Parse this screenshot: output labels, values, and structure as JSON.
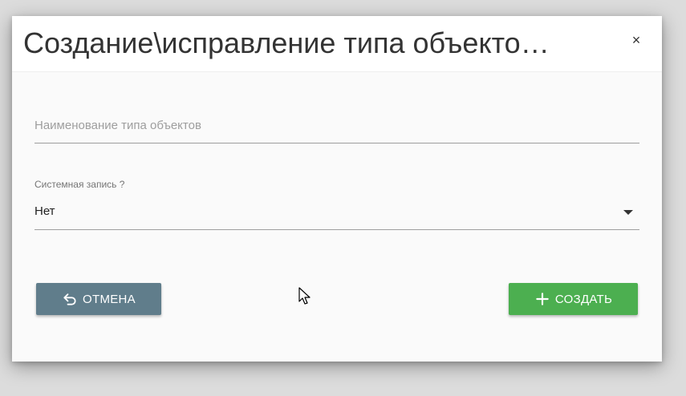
{
  "dialog": {
    "title": "Создание\\исправление типа объекто…",
    "close_label": "×"
  },
  "form": {
    "name_field": {
      "placeholder": "Наименование типа объектов",
      "value": ""
    },
    "system_record": {
      "label": "Системная запись ?",
      "selected": "Нет"
    }
  },
  "actions": {
    "cancel_label": "ОТМЕНА",
    "create_label": "СОЗДАТЬ"
  },
  "colors": {
    "cancel_button": "#607d8b",
    "create_button": "#4caf50"
  },
  "icons": {
    "cancel": "undo-icon",
    "create": "plus-icon",
    "select": "caret-down-icon",
    "close": "close-icon"
  }
}
